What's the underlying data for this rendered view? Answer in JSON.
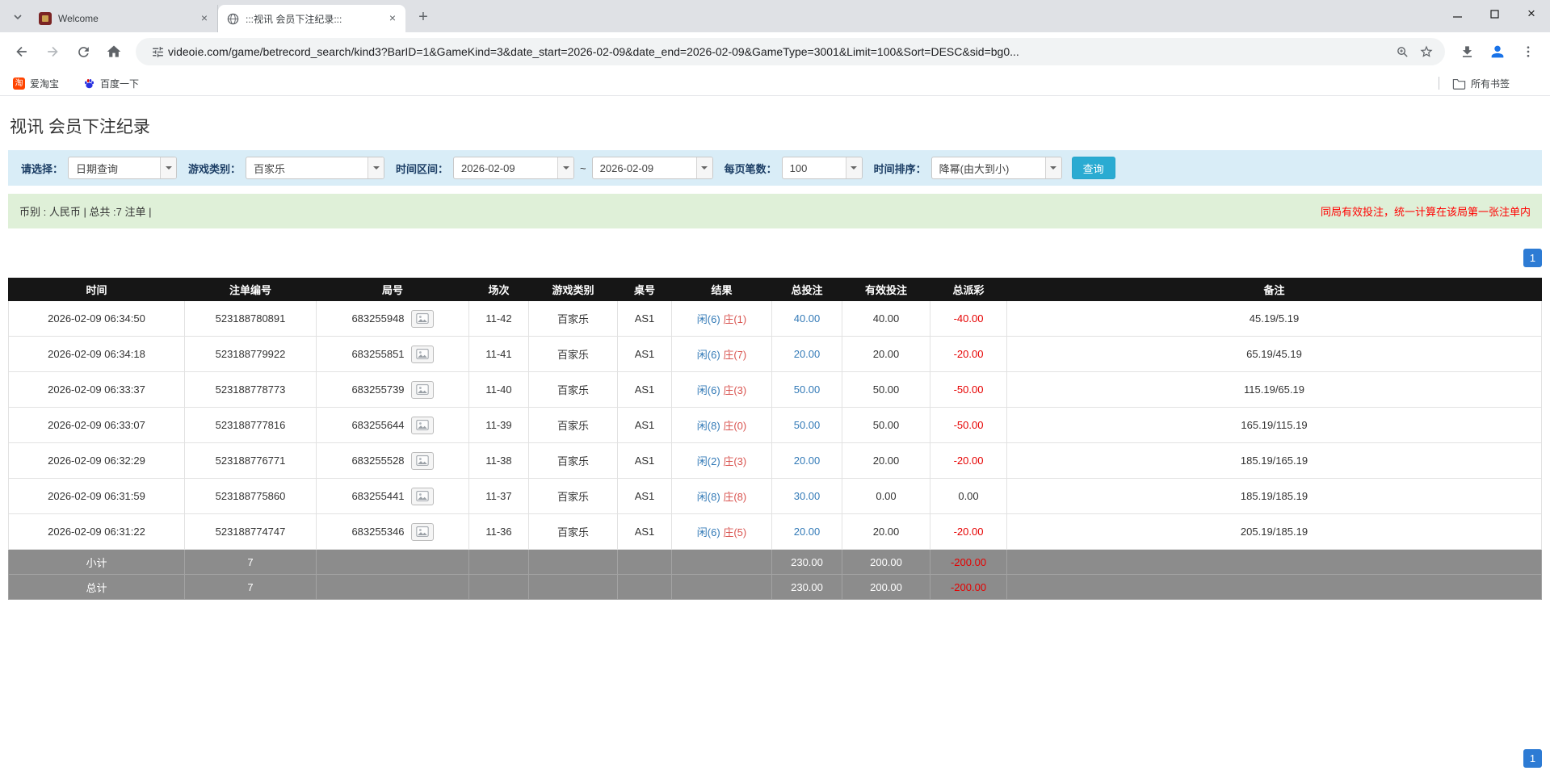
{
  "browser": {
    "tab_search_tooltip": "tab-search",
    "tabs": [
      {
        "title": "Welcome"
      },
      {
        "title": ":::视讯 会员下注纪录:::"
      }
    ],
    "url": "videoie.com/game/betrecord_search/kind3?BarID=1&GameKind=3&date_start=2026-02-09&date_end=2026-02-09&GameType=3001&Limit=100&Sort=DESC&sid=bg0...",
    "bookmarks": [
      {
        "label": "爱淘宝",
        "icon_glyph": "淘"
      },
      {
        "label": "百度一下"
      }
    ],
    "all_bookmarks_label": "所有书签"
  },
  "page": {
    "title": "视讯 会员下注纪录",
    "filter": {
      "select_label": "请选择：",
      "select_value": "日期查询",
      "game_label": "游戏类别：",
      "game_value": "百家乐",
      "range_label": "时间区间：",
      "date_start": "2026-02-09",
      "tilde": "~",
      "date_end": "2026-02-09",
      "per_page_label": "每页笔数：",
      "per_page_value": "100",
      "sort_label": "时间排序：",
      "sort_value": "降幂(由大到小)",
      "search_label": "查询"
    },
    "summary": {
      "left": "币别 : 人民币 | 总共 :7 注单 |",
      "notice": "同局有效投注，统一计算在该局第一张注单内"
    },
    "pagination": {
      "page": "1"
    }
  },
  "table": {
    "headers": [
      "时间",
      "注单编号",
      "局号",
      "场次",
      "游戏类别",
      "桌号",
      "结果",
      "总投注",
      "有效投注",
      "总派彩",
      "备注"
    ],
    "rows": [
      {
        "time": "2026-02-09 06:34:50",
        "bet_id": "523188780891",
        "round_id": "683255948",
        "session": "11-42",
        "game": "百家乐",
        "table_no": "AS1",
        "result_player": "闲(6)",
        "result_banker": "庄(1)",
        "total_bet": "40.00",
        "valid_bet": "40.00",
        "payout": "-40.00",
        "note": "45.19/5.19"
      },
      {
        "time": "2026-02-09 06:34:18",
        "bet_id": "523188779922",
        "round_id": "683255851",
        "session": "11-41",
        "game": "百家乐",
        "table_no": "AS1",
        "result_player": "闲(6)",
        "result_banker": "庄(7)",
        "total_bet": "20.00",
        "valid_bet": "20.00",
        "payout": "-20.00",
        "note": "65.19/45.19"
      },
      {
        "time": "2026-02-09 06:33:37",
        "bet_id": "523188778773",
        "round_id": "683255739",
        "session": "11-40",
        "game": "百家乐",
        "table_no": "AS1",
        "result_player": "闲(6)",
        "result_banker": "庄(3)",
        "total_bet": "50.00",
        "valid_bet": "50.00",
        "payout": "-50.00",
        "note": "115.19/65.19"
      },
      {
        "time": "2026-02-09 06:33:07",
        "bet_id": "523188777816",
        "round_id": "683255644",
        "session": "11-39",
        "game": "百家乐",
        "table_no": "AS1",
        "result_player": "闲(8)",
        "result_banker": "庄(0)",
        "total_bet": "50.00",
        "valid_bet": "50.00",
        "payout": "-50.00",
        "note": "165.19/115.19"
      },
      {
        "time": "2026-02-09 06:32:29",
        "bet_id": "523188776771",
        "round_id": "683255528",
        "session": "11-38",
        "game": "百家乐",
        "table_no": "AS1",
        "result_player": "闲(2)",
        "result_banker": "庄(3)",
        "total_bet": "20.00",
        "valid_bet": "20.00",
        "payout": "-20.00",
        "note": "185.19/165.19"
      },
      {
        "time": "2026-02-09 06:31:59",
        "bet_id": "523188775860",
        "round_id": "683255441",
        "session": "11-37",
        "game": "百家乐",
        "table_no": "AS1",
        "result_player": "闲(8)",
        "result_banker": "庄(8)",
        "total_bet": "30.00",
        "valid_bet": "0.00",
        "payout": "0.00",
        "note": "185.19/185.19"
      },
      {
        "time": "2026-02-09 06:31:22",
        "bet_id": "523188774747",
        "round_id": "683255346",
        "session": "11-36",
        "game": "百家乐",
        "table_no": "AS1",
        "result_player": "闲(6)",
        "result_banker": "庄(5)",
        "total_bet": "20.00",
        "valid_bet": "20.00",
        "payout": "-20.00",
        "note": "205.19/185.19"
      }
    ],
    "subtotal": {
      "label": "小计",
      "count": "7",
      "total_bet": "230.00",
      "valid_bet": "200.00",
      "payout": "-200.00"
    },
    "total": {
      "label": "总计",
      "count": "7",
      "total_bet": "230.00",
      "valid_bet": "200.00",
      "payout": "-200.00"
    }
  }
}
